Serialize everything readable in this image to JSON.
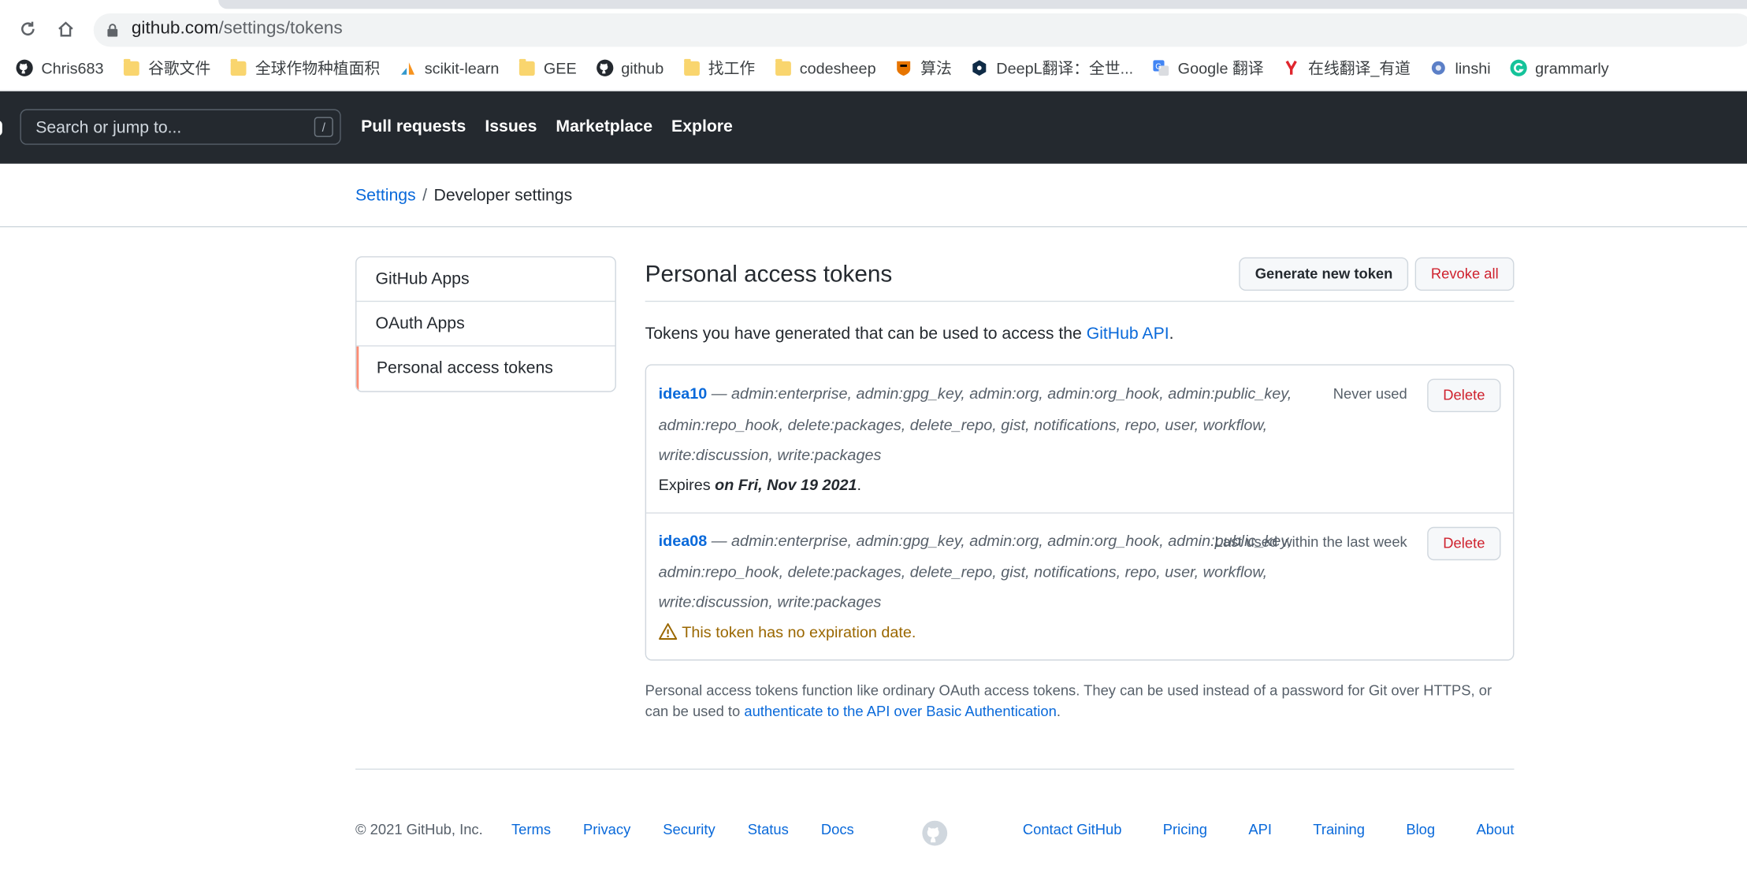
{
  "browser": {
    "url_host": "github.com",
    "url_path": "/settings/tokens",
    "bookmarks": [
      {
        "label": "Chris683",
        "icon": "github-icon"
      },
      {
        "label": "谷歌文件",
        "icon": "folder-icon"
      },
      {
        "label": "全球作物种植面积",
        "icon": "folder-icon"
      },
      {
        "label": "scikit-learn",
        "icon": "scikit-learn-icon"
      },
      {
        "label": "GEE",
        "icon": "folder-icon"
      },
      {
        "label": "github",
        "icon": "github-icon"
      },
      {
        "label": "找工作",
        "icon": "folder-icon"
      },
      {
        "label": "codesheep",
        "icon": "folder-icon"
      },
      {
        "label": "算法",
        "icon": "princeton-icon"
      },
      {
        "label": "DeepL翻译：全世...",
        "icon": "deepl-icon"
      },
      {
        "label": "Google 翻译",
        "icon": "google-translate-icon"
      },
      {
        "label": "在线翻译_有道",
        "icon": "youdao-icon"
      },
      {
        "label": "linshi",
        "icon": "linshi-icon"
      },
      {
        "label": "grammarly",
        "icon": "grammarly-icon"
      }
    ]
  },
  "header": {
    "search_placeholder": "Search or jump to...",
    "search_key": "/",
    "nav": [
      "Pull requests",
      "Issues",
      "Marketplace",
      "Explore"
    ]
  },
  "breadcrumb": {
    "parent": "Settings",
    "separator": "/",
    "current": "Developer settings"
  },
  "sidebar": {
    "items": [
      {
        "label": "GitHub Apps"
      },
      {
        "label": "OAuth Apps"
      },
      {
        "label": "Personal access tokens"
      }
    ]
  },
  "main": {
    "title": "Personal access tokens",
    "generate_button": "Generate new token",
    "revoke_button": "Revoke all",
    "intro_text": "Tokens you have generated that can be used to access the ",
    "intro_link": "GitHub API",
    "intro_end": ".",
    "tokens": [
      {
        "name": "idea10",
        "dash": " — ",
        "scopes": "admin:enterprise, admin:gpg_key, admin:org, admin:org_hook, admin:public_key, admin:repo_hook, delete:packages, delete_repo, gist, notifications, repo, user, workflow, write:discussion, write:packages",
        "usage": "Never used",
        "delete_label": "Delete",
        "expires_prefix": "Expires ",
        "expires_date": "on Fri, Nov 19 2021",
        "expires_suffix": "."
      },
      {
        "name": "idea08",
        "dash": " — ",
        "scopes": "admin:enterprise, admin:gpg_key, admin:org, admin:org_hook, admin:public_key, admin:repo_hook, delete:packages, delete_repo, gist, notifications, repo, user, workflow, write:discussion, write:packages",
        "usage": "Last used within the last week",
        "delete_label": "Delete",
        "warning": "This token has no expiration date."
      }
    ],
    "note_text": "Personal access tokens function like ordinary OAuth access tokens. They can be used instead of a password for Git over HTTPS, or can be used to ",
    "note_link": "authenticate to the API over Basic Authentication",
    "note_end": "."
  },
  "footer": {
    "copyright": "© 2021 GitHub, Inc.",
    "left_links": [
      "Terms",
      "Privacy",
      "Security",
      "Status",
      "Docs"
    ],
    "right_links": [
      "Contact GitHub",
      "Pricing",
      "API",
      "Training",
      "Blog",
      "About"
    ]
  },
  "colors": {
    "header_bg": "#24292f",
    "link": "#0969da",
    "danger": "#cf222e",
    "warning": "#9a6700",
    "selected_accent": "#fd8c73"
  }
}
